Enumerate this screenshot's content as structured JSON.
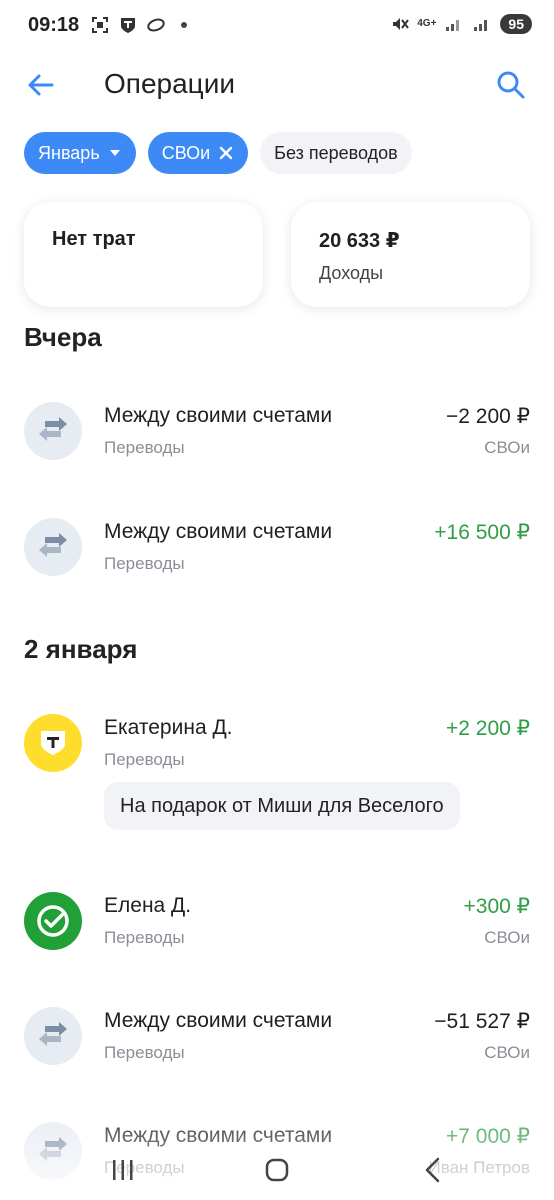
{
  "status": {
    "time": "09:18",
    "net": "4G+",
    "battery": "95"
  },
  "header": {
    "title": "Операции"
  },
  "filters": {
    "month": "Январь",
    "account": "СВОи",
    "transfers": "Без переводов"
  },
  "summary": {
    "expenses_label": "Нет трат",
    "income_amount": "20 633 ₽",
    "income_label": "Доходы"
  },
  "sections": [
    {
      "title": "Вчера",
      "items": [
        {
          "name": "Между своими счетами",
          "category": "Переводы",
          "amount": "−2 200 ₽",
          "account": "СВОи"
        },
        {
          "name": "Между своими счетами",
          "category": "Переводы",
          "amount": "+16 500 ₽",
          "account": ""
        }
      ]
    },
    {
      "title": "2 января",
      "items": [
        {
          "name": "Екатерина Д.",
          "category": "Переводы",
          "amount": "+2 200 ₽",
          "account": "",
          "comment": "На подарок от Миши для Веселого"
        },
        {
          "name": "Елена Д.",
          "category": "Переводы",
          "amount": "+300 ₽",
          "account": "СВОи"
        },
        {
          "name": "Между своими счетами",
          "category": "Переводы",
          "amount": "−51 527 ₽",
          "account": "СВОи"
        },
        {
          "name": "Между своими счетами",
          "category": "Переводы",
          "amount": "+7 000 ₽",
          "account": "Иван Петров"
        }
      ]
    }
  ],
  "colors": {
    "accent": "#3d8af7",
    "positive": "#2f9e44",
    "muted": "#8a8f97"
  }
}
